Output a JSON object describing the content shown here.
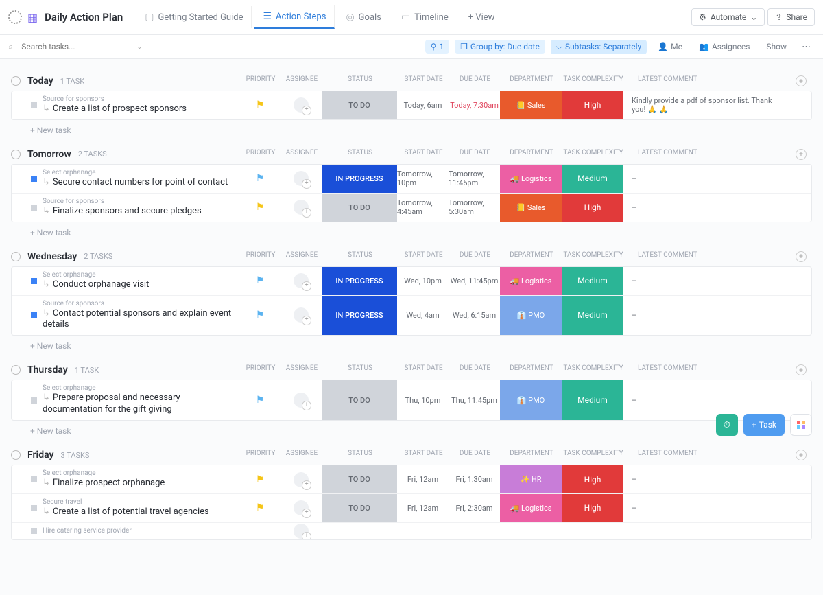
{
  "header": {
    "title": "Daily Action Plan",
    "tabs": [
      {
        "label": "Getting Started Guide"
      },
      {
        "label": "Action Steps"
      },
      {
        "label": "Goals"
      },
      {
        "label": "Timeline"
      }
    ],
    "add_view": "+ View",
    "automate": "Automate",
    "share": "Share"
  },
  "filters": {
    "search_placeholder": "Search tasks...",
    "filter_count": "1",
    "group_by": "Group by: Due date",
    "subtasks": "Subtasks: Separately",
    "me": "Me",
    "assignees": "Assignees",
    "show": "Show"
  },
  "columns": {
    "priority": "PRIORITY",
    "assignee": "ASSIGNEE",
    "status": "STATUS",
    "start": "START DATE",
    "due": "DUE DATE",
    "dept": "DEPARTMENT",
    "complex": "TASK COMPLEXITY",
    "comment": "LATEST COMMENT"
  },
  "new_task": "+ New task",
  "groups": [
    {
      "title": "Today",
      "count": "1 TASK",
      "rows": [
        {
          "sq": "grey",
          "parent": "Source for sponsors",
          "title": "Create a list of prospect sponsors",
          "flag": "y",
          "status": "TO DO",
          "st": "todo",
          "start": "Today, 6am",
          "due": "Today, 7:30am",
          "due_red": true,
          "dept": "Sales",
          "deptc": "sales",
          "dicon": "📒",
          "cx": "High",
          "cxc": "high",
          "comment": "Kindly provide a pdf of sponsor list. Thank you! 🙏 🙏"
        }
      ]
    },
    {
      "title": "Tomorrow",
      "count": "2 TASKS",
      "rows": [
        {
          "sq": "blue",
          "parent": "Select orphanage",
          "title": "Secure contact numbers for point of contact",
          "flag": "b",
          "status": "IN PROGRESS",
          "st": "prog",
          "start": "Tomorrow, 10pm",
          "due": "Tomorrow, 11:45pm",
          "dept": "Logistics",
          "deptc": "log",
          "dicon": "🚚",
          "cx": "Medium",
          "cxc": "med",
          "comment": "–"
        },
        {
          "sq": "grey",
          "parent": "Source for sponsors",
          "title": "Finalize sponsors and secure pledges",
          "flag": "y",
          "status": "TO DO",
          "st": "todo",
          "start": "Tomorrow, 4:45am",
          "due": "Tomorrow, 5:30am",
          "dept": "Sales",
          "deptc": "sales",
          "dicon": "📒",
          "cx": "High",
          "cxc": "high",
          "comment": "–"
        }
      ]
    },
    {
      "title": "Wednesday",
      "count": "2 TASKS",
      "rows": [
        {
          "sq": "blue",
          "parent": "Select orphanage",
          "title": "Conduct orphanage visit",
          "flag": "b",
          "status": "IN PROGRESS",
          "st": "prog",
          "start": "Wed, 10pm",
          "due": "Wed, 11:45pm",
          "dept": "Logistics",
          "deptc": "log",
          "dicon": "🚚",
          "cx": "Medium",
          "cxc": "med",
          "comment": "–"
        },
        {
          "sq": "blue",
          "parent": "Source for sponsors",
          "title": "Contact potential sponsors and explain event details",
          "flag": "b",
          "status": "IN PROGRESS",
          "st": "prog",
          "start": "Wed, 4am",
          "due": "Wed, 6:15am",
          "dept": "PMO",
          "deptc": "pmo",
          "dicon": "👔",
          "cx": "Medium",
          "cxc": "med",
          "comment": "–"
        }
      ]
    },
    {
      "title": "Thursday",
      "count": "1 TASK",
      "rows": [
        {
          "sq": "grey",
          "parent": "Select orphanage",
          "title": "Prepare proposal and necessary documentation for the gift giving",
          "flag": "b",
          "status": "TO DO",
          "st": "todo",
          "start": "Thu, 10pm",
          "due": "Thu, 11:45pm",
          "dept": "PMO",
          "deptc": "pmo",
          "dicon": "👔",
          "cx": "Medium",
          "cxc": "med",
          "comment": "–"
        }
      ]
    },
    {
      "title": "Friday",
      "count": "3 TASKS",
      "no_newtask": true,
      "rows": [
        {
          "sq": "grey",
          "parent": "Select orphanage",
          "title": "Finalize prospect orphanage",
          "flag": "y",
          "status": "TO DO",
          "st": "todo",
          "start": "Fri, 12am",
          "due": "Fri, 1:30am",
          "dept": "HR",
          "deptc": "hr",
          "dicon": "✨",
          "cx": "High",
          "cxc": "high",
          "comment": "–"
        },
        {
          "sq": "grey",
          "parent": "Secure travel",
          "title": "Create a list of potential travel agencies",
          "flag": "y",
          "status": "TO DO",
          "st": "todo",
          "start": "Fri, 12am",
          "due": "Fri, 2:30am",
          "dept": "Logistics",
          "deptc": "log",
          "dicon": "🚚",
          "cx": "High",
          "cxc": "high",
          "comment": "–"
        },
        {
          "sq": "grey",
          "parent": "Hire catering service provider",
          "title": "",
          "flag": "",
          "status": "",
          "st": "",
          "start": "",
          "due": "",
          "dept": "",
          "deptc": "",
          "dicon": "",
          "cx": "",
          "cxc": "",
          "comment": ""
        }
      ]
    }
  ],
  "fab": {
    "task": "Task"
  }
}
